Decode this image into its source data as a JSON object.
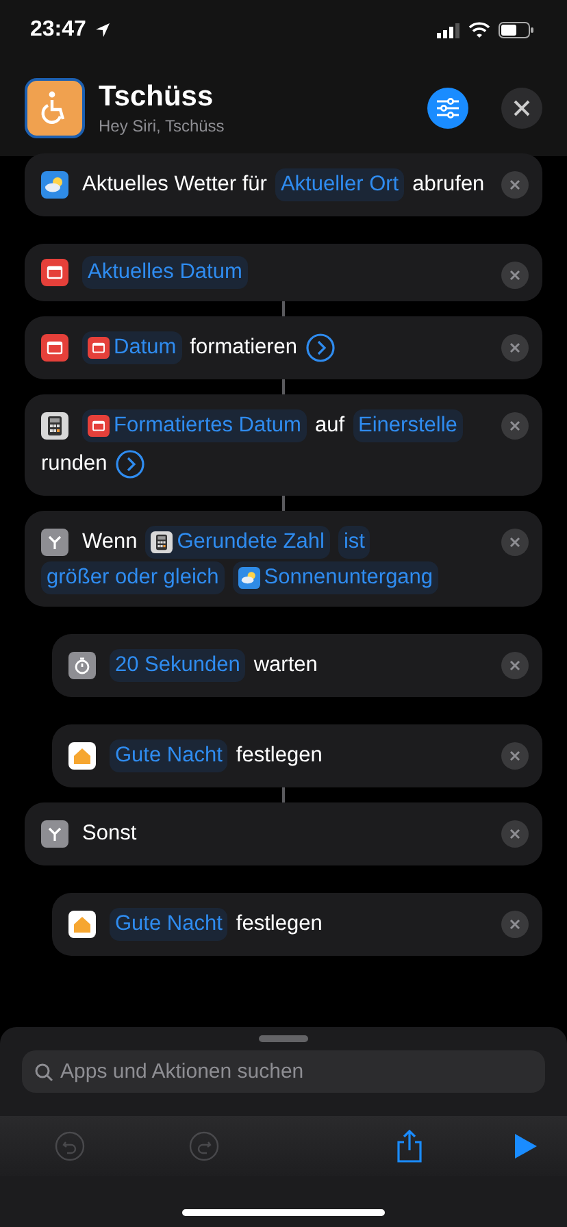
{
  "status_bar": {
    "time": "23:47"
  },
  "header": {
    "title": "Tschüss",
    "subtitle": "Hey Siri, Tschüss"
  },
  "actions": [
    {
      "indented": false,
      "parts": [
        {
          "kind": "text",
          "text": "Aktuelles Wetter für"
        },
        {
          "kind": "token",
          "text": "Aktueller Ort"
        },
        {
          "kind": "text",
          "text": "abrufen"
        }
      ]
    },
    {
      "indented": false,
      "parts": [
        {
          "kind": "token",
          "text": "Aktuelles Datum"
        }
      ]
    },
    {
      "indented": false,
      "parts": [
        {
          "kind": "token",
          "text": "Datum"
        },
        {
          "kind": "text",
          "text": "formatieren"
        },
        {
          "kind": "chevron"
        }
      ]
    },
    {
      "indented": false,
      "parts": [
        {
          "kind": "token",
          "text": "Formatiertes Datum"
        },
        {
          "kind": "text",
          "text": "auf"
        },
        {
          "kind": "token",
          "text": "Einerstelle"
        },
        {
          "kind": "text",
          "text": "runden"
        },
        {
          "kind": "chevron"
        }
      ]
    },
    {
      "indented": false,
      "parts": [
        {
          "kind": "text",
          "text": "Wenn"
        },
        {
          "kind": "token",
          "text": "Gerundete Zahl"
        },
        {
          "kind": "token",
          "text": "ist"
        },
        {
          "kind": "token",
          "text": "größer oder gleich"
        },
        {
          "kind": "token",
          "text": "Sonnenuntergang"
        }
      ]
    },
    {
      "indented": true,
      "parts": [
        {
          "kind": "token",
          "text": "20 Sekunden"
        },
        {
          "kind": "text",
          "text": "warten"
        }
      ]
    },
    {
      "indented": true,
      "parts": [
        {
          "kind": "token",
          "text": "Gute Nacht"
        },
        {
          "kind": "text",
          "text": "festlegen"
        }
      ]
    },
    {
      "indented": false,
      "parts": [
        {
          "kind": "text",
          "text": "Sonst"
        }
      ]
    },
    {
      "indented": true,
      "parts": [
        {
          "kind": "token",
          "text": "Gute Nacht"
        },
        {
          "kind": "text",
          "text": "festlegen"
        }
      ]
    }
  ],
  "search": {
    "placeholder": "Apps und Aktionen suchen"
  },
  "toolbar": [
    {
      "kind": "undo",
      "disabled": true
    },
    {
      "kind": "redo",
      "disabled": true
    },
    {
      "kind": "share",
      "disabled": false
    },
    {
      "kind": "play",
      "disabled": false
    }
  ]
}
